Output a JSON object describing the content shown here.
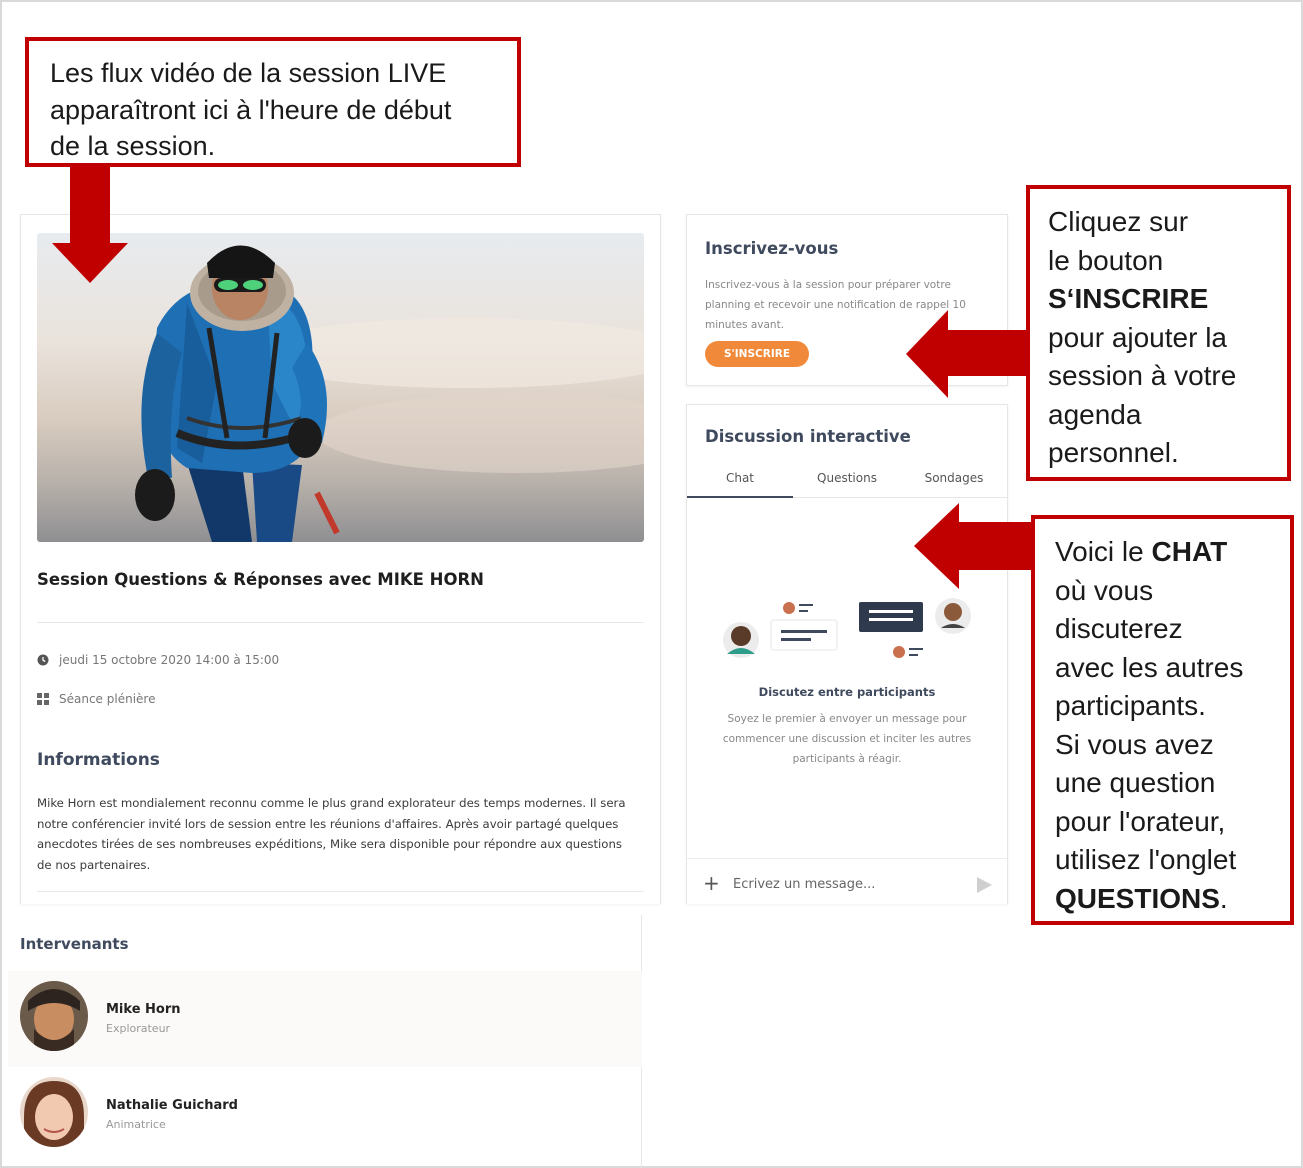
{
  "callouts": {
    "video": {
      "lines": [
        "Les flux vidéo de la session LIVE",
        "apparaîtront ici à l'heure de début",
        "de la session."
      ]
    },
    "register": {
      "line1": "Cliquez sur",
      "line2": "le bouton",
      "line3_bold": "S‘INSCRIRE",
      "line4": "pour ajouter la",
      "line5": "session à votre",
      "line6": "agenda",
      "line7": "personnel."
    },
    "chat": {
      "line1_prefix": "Voici le ",
      "line1_bold": "CHAT",
      "line2": "où vous",
      "line3": "discuterez",
      "line4": "avec les autres",
      "line5": "participants.",
      "line6": "Si vous avez",
      "line7": "une question",
      "line8": "pour l'orateur,",
      "line9": "utilisez l'onglet",
      "line10_bold": "QUESTIONS",
      "line10_suffix": "."
    },
    "accent_color": "#c00000"
  },
  "session": {
    "title": "Session Questions & Réponses avec MIKE HORN",
    "datetime": "jeudi 15 octobre 2020 14:00 à 15:00",
    "type": "Séance plénière",
    "info_heading": "Informations",
    "info_text": "Mike Horn est mondialement reconnu comme le plus grand explorateur des temps modernes. Il sera notre conférencier invité lors de session entre les réunions d'affaires. Après avoir partagé  quelques anecdotes tirées de ses nombreuses expéditions, Mike sera disponible pour répondre aux questions de nos partenaires."
  },
  "speakers": {
    "heading": "Intervenants",
    "items": [
      {
        "name": "Mike Horn",
        "role": "Explorateur"
      },
      {
        "name": "Nathalie Guichard",
        "role": "Animatrice"
      }
    ]
  },
  "register": {
    "title": "Inscrivez-vous",
    "text": "Inscrivez-vous à la session pour préparer votre planning et recevoir une notification de rappel 10 minutes avant.",
    "button": "S'INSCRIRE",
    "button_color": "#f08a3a"
  },
  "chat": {
    "title": "Discussion interactive",
    "tabs": [
      "Chat",
      "Questions",
      "Sondages"
    ],
    "active_tab": "Chat",
    "empty_title": "Discutez entre participants",
    "empty_text": "Soyez le premier à envoyer un message pour commencer une discussion et inciter les autres participants à réagir.",
    "input_placeholder": "Écrivez un message..."
  }
}
